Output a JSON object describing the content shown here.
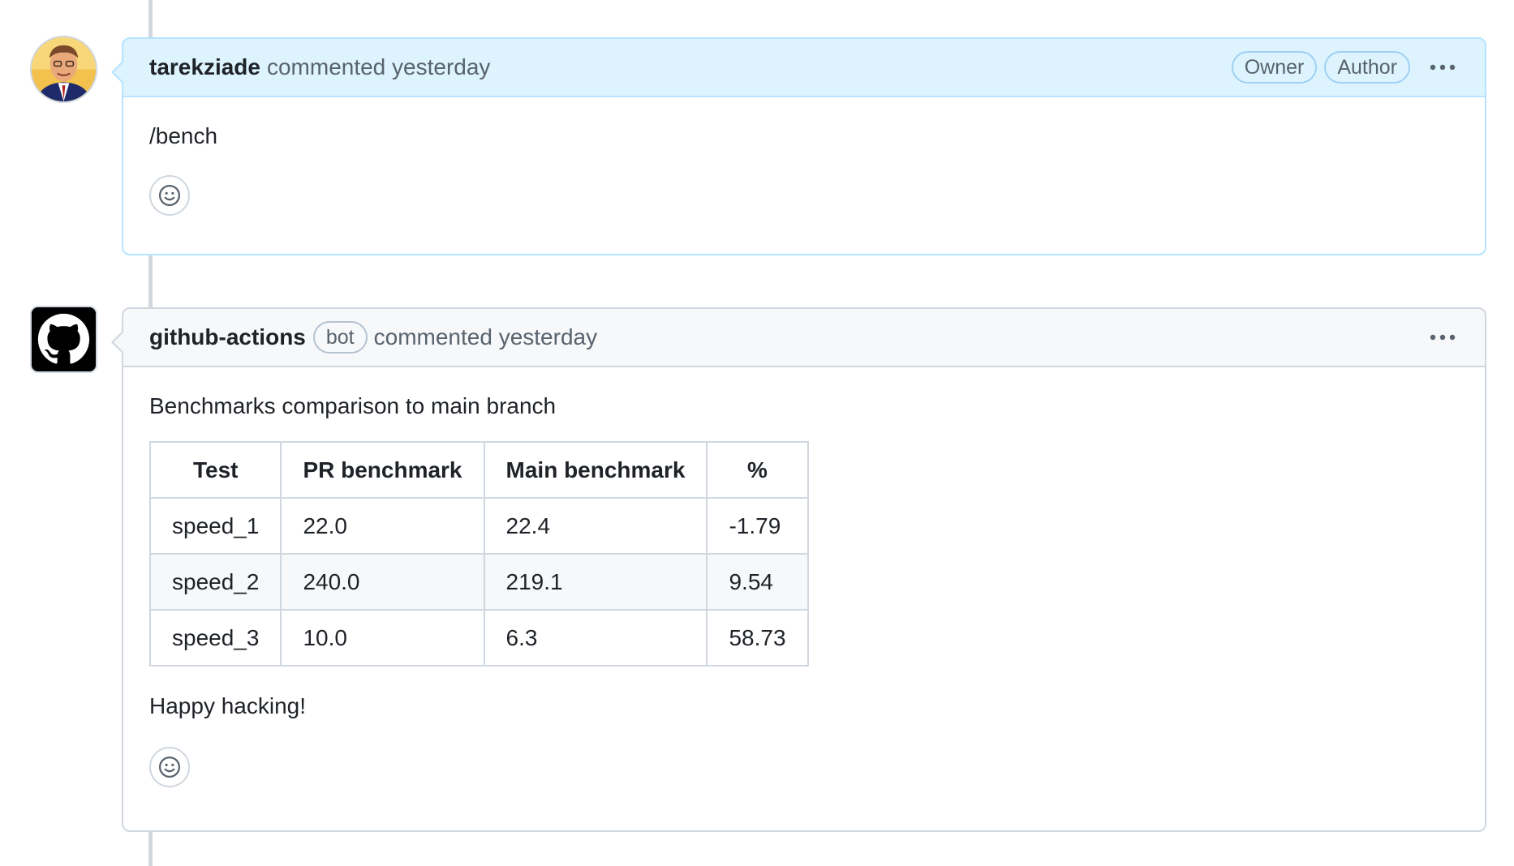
{
  "comments": [
    {
      "author": "tarekziade",
      "action": "commented yesterday",
      "labels": [
        "Owner",
        "Author"
      ],
      "body": "/bench",
      "avatar_icon": "user-portrait-avatar"
    },
    {
      "author": "github-actions",
      "bot_label": "bot",
      "action": "commented yesterday",
      "intro": "Benchmarks comparison to main branch",
      "table": {
        "headers": [
          "Test",
          "PR benchmark",
          "Main benchmark",
          "%"
        ],
        "rows": [
          [
            "speed_1",
            "22.0",
            "22.4",
            "-1.79"
          ],
          [
            "speed_2",
            "240.0",
            "219.1",
            "9.54"
          ],
          [
            "speed_3",
            "10.0",
            "6.3",
            "58.73"
          ]
        ]
      },
      "outro": "Happy hacking!",
      "avatar_icon": "github-octocat-logo"
    }
  ],
  "colors": {
    "owner_header_bg": "#ddf4ff",
    "owner_border": "#b6e3ff",
    "default_header_bg": "#f6f8fa",
    "border": "#d0d7de"
  }
}
